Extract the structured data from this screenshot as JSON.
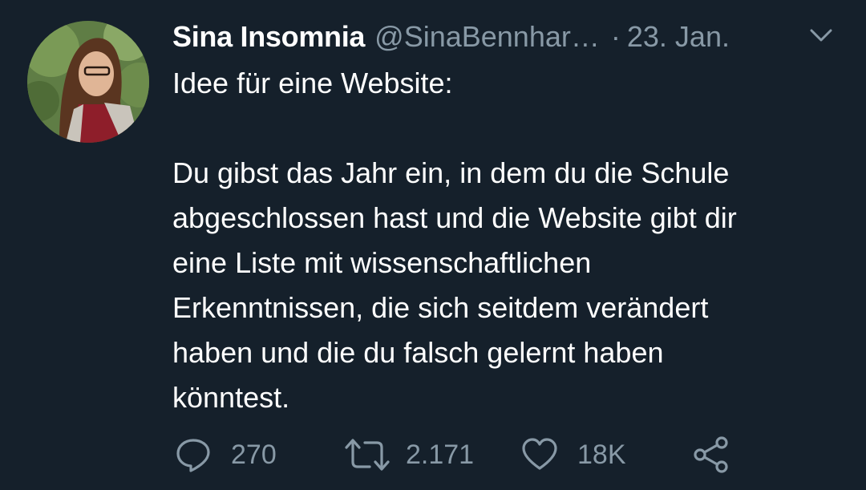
{
  "tweet": {
    "author_name": "Sina Insomnia",
    "author_handle": "@SinaBennhar…",
    "separator": "·",
    "date": "23. Jan.",
    "text_lines": [
      "Idee für eine Website:",
      "",
      "Du gibst das Jahr ein, in dem du die Schule",
      "abgeschlossen hast und die Website gibt dir",
      "eine Liste mit wissenschaftlichen",
      "Erkenntnissen, die sich seitdem verändert",
      "haben und die du falsch gelernt haben",
      "könntest."
    ]
  },
  "actions": {
    "reply_count": "270",
    "retweet_count": "2.171",
    "like_count": "18K"
  },
  "icons": {
    "avatar": "profile-photo",
    "menu": "chevron-down-icon",
    "reply": "reply-icon",
    "retweet": "retweet-icon",
    "like": "heart-icon",
    "share": "share-icon"
  },
  "colors": {
    "background": "#15202b",
    "text": "#ffffff",
    "secondary": "#8899a6"
  }
}
